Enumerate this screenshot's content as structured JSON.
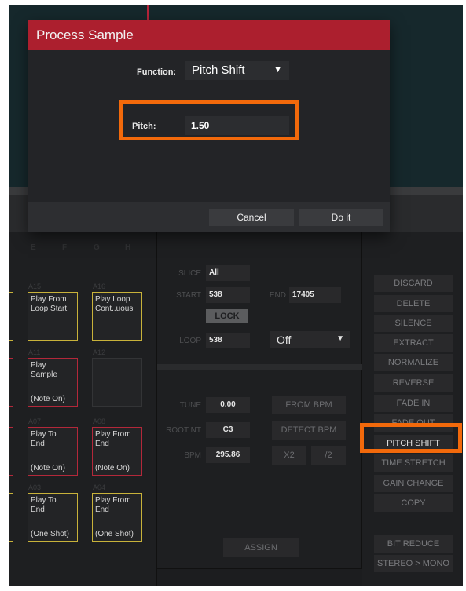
{
  "dialog": {
    "title": "Process Sample",
    "function_label": "Function:",
    "function_value": "Pitch Shift",
    "pitch_label": "Pitch:",
    "pitch_value": "1.50",
    "cancel_label": "Cancel",
    "doit_label": "Do it"
  },
  "pad_grid": {
    "column_headers": [
      "E",
      "F",
      "G",
      "H"
    ],
    "pads": [
      {
        "name": "A15",
        "line1": "Play From\nLoop Start",
        "line2": ""
      },
      {
        "name": "A16",
        "line1": "Play Loop\nCont..uous",
        "line2": ""
      },
      {
        "name": "A11",
        "line1": "Play\nSample",
        "line2": "(Note On)"
      },
      {
        "name": "A12",
        "line1": "",
        "line2": ""
      },
      {
        "name": "A07",
        "line1": "Play To\nEnd",
        "line2": "(Note On)"
      },
      {
        "name": "A08",
        "line1": "Play From\nEnd",
        "line2": "(Note On)"
      },
      {
        "name": "A03",
        "line1": "Play To\nEnd",
        "line2": "(One Shot)"
      },
      {
        "name": "A04",
        "line1": "Play From\nEnd",
        "line2": "(One Shot)"
      }
    ]
  },
  "slice_panel": {
    "slice_label": "SLICE",
    "slice_value": "All",
    "start_label": "START",
    "start_value": "538",
    "end_label": "END",
    "end_value": "17405",
    "lock_label": "LOCK",
    "loop_label": "LOOP",
    "loop_value": "538",
    "loop_mode": "Off"
  },
  "tune_panel": {
    "tune_label": "TUNE",
    "tune_value": "0.00",
    "root_label": "ROOT NT",
    "root_value": "C3",
    "bpm_label": "BPM",
    "bpm_value": "295.86",
    "from_bpm": "FROM BPM",
    "detect_bpm": "DETECT BPM",
    "x2": "X2",
    "div2": "/2",
    "assign": "ASSIGN"
  },
  "process_buttons": [
    "DISCARD",
    "DELETE",
    "SILENCE",
    "EXTRACT",
    "NORMALIZE",
    "REVERSE",
    "FADE IN",
    "FADE OUT",
    "PITCH SHIFT",
    "TIME STRETCH",
    "GAIN CHANGE",
    "COPY",
    "BIT REDUCE",
    "STEREO > MONO"
  ],
  "colors": {
    "dialog_title_bg": "#ac1f2e",
    "highlight": "#f2690b",
    "pad_yellow": "#c8b23a",
    "pad_red": "#b3283a"
  }
}
